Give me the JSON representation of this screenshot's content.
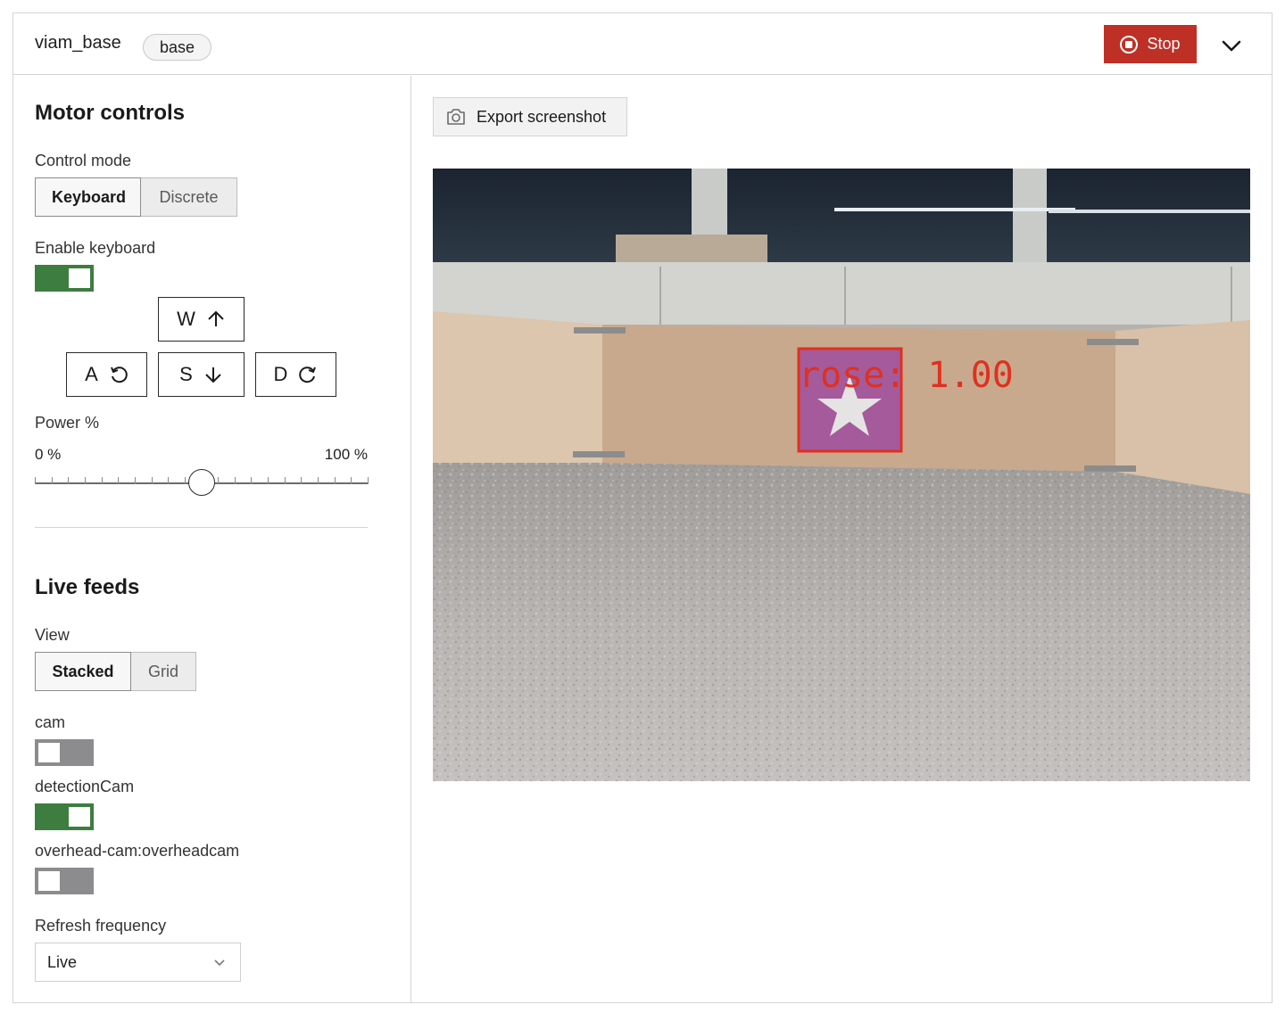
{
  "header": {
    "title": "viam_base",
    "badge": "base",
    "stop_label": "Stop",
    "stop_color": "#be3026"
  },
  "motor": {
    "heading": "Motor controls",
    "control_mode_label": "Control mode",
    "modes": [
      "Keyboard",
      "Discrete"
    ],
    "active_mode": "Keyboard",
    "enable_keyboard_label": "Enable keyboard",
    "keyboard_enabled": true,
    "keys": {
      "w": "W",
      "a": "A",
      "s": "S",
      "d": "D"
    },
    "power_label": "Power %",
    "power_min_label": "0 %",
    "power_max_label": "100 %",
    "power_value": 50
  },
  "feeds": {
    "heading": "Live feeds",
    "view_label": "View",
    "views": [
      "Stacked",
      "Grid"
    ],
    "active_view": "Stacked",
    "cameras": [
      {
        "name": "cam",
        "enabled": false
      },
      {
        "name": "detectionCam",
        "enabled": true
      },
      {
        "name": "overhead-cam:overheadcam",
        "enabled": false
      }
    ],
    "refresh_label": "Refresh frequency",
    "refresh_value": "Live"
  },
  "viewer": {
    "export_label": "Export screenshot",
    "detection_label": "rose: 1.00",
    "detection_color": "#e0301e"
  },
  "colors": {
    "toggle_on": "#3d7d3f",
    "toggle_off": "#8c8c8f"
  }
}
